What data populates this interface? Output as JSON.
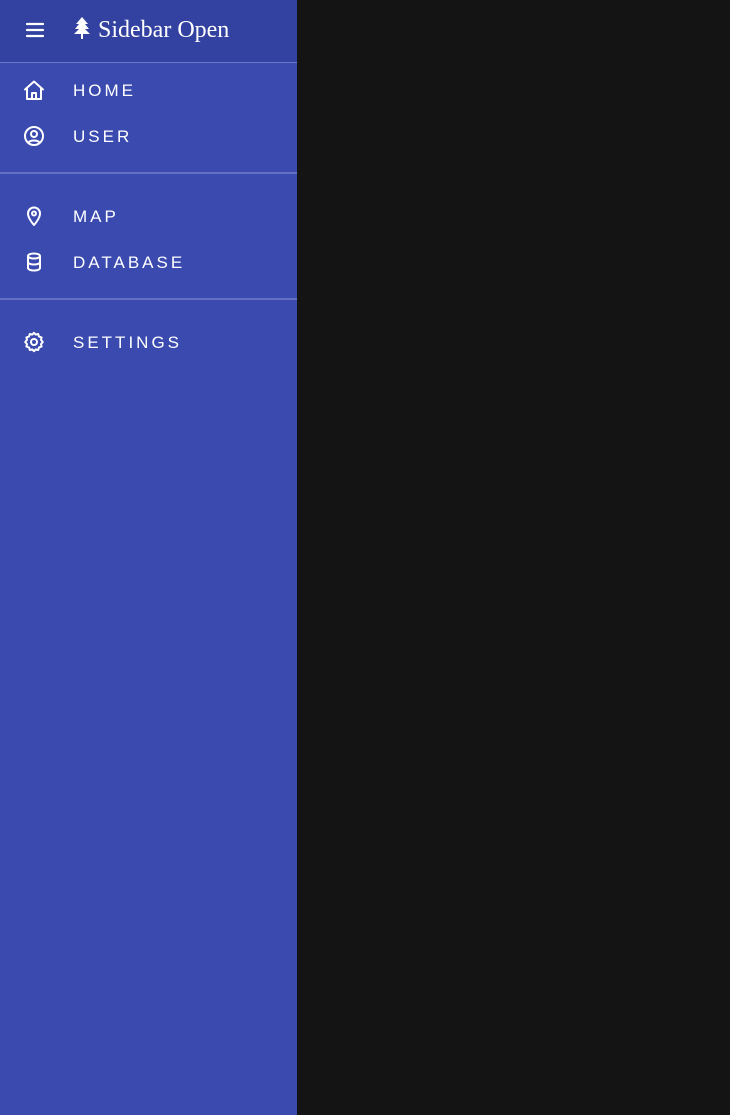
{
  "header": {
    "title": "Sidebar Open",
    "menu_icon": "hamburger-menu-icon",
    "brand_icon": "tree-icon"
  },
  "sidebar": {
    "groups": [
      {
        "items": [
          {
            "label": "HOME",
            "icon": "home-icon"
          },
          {
            "label": "USER",
            "icon": "user-circle-icon"
          }
        ]
      },
      {
        "items": [
          {
            "label": "MAP",
            "icon": "map-pin-icon"
          },
          {
            "label": "DATABASE",
            "icon": "database-icon"
          }
        ]
      },
      {
        "items": [
          {
            "label": "SETTINGS",
            "icon": "gear-icon"
          }
        ]
      }
    ]
  },
  "colors": {
    "sidebar_background": "#3a4aaf",
    "topbar_background": "#3342a0",
    "content_background": "#141414",
    "text": "#ffffff"
  }
}
